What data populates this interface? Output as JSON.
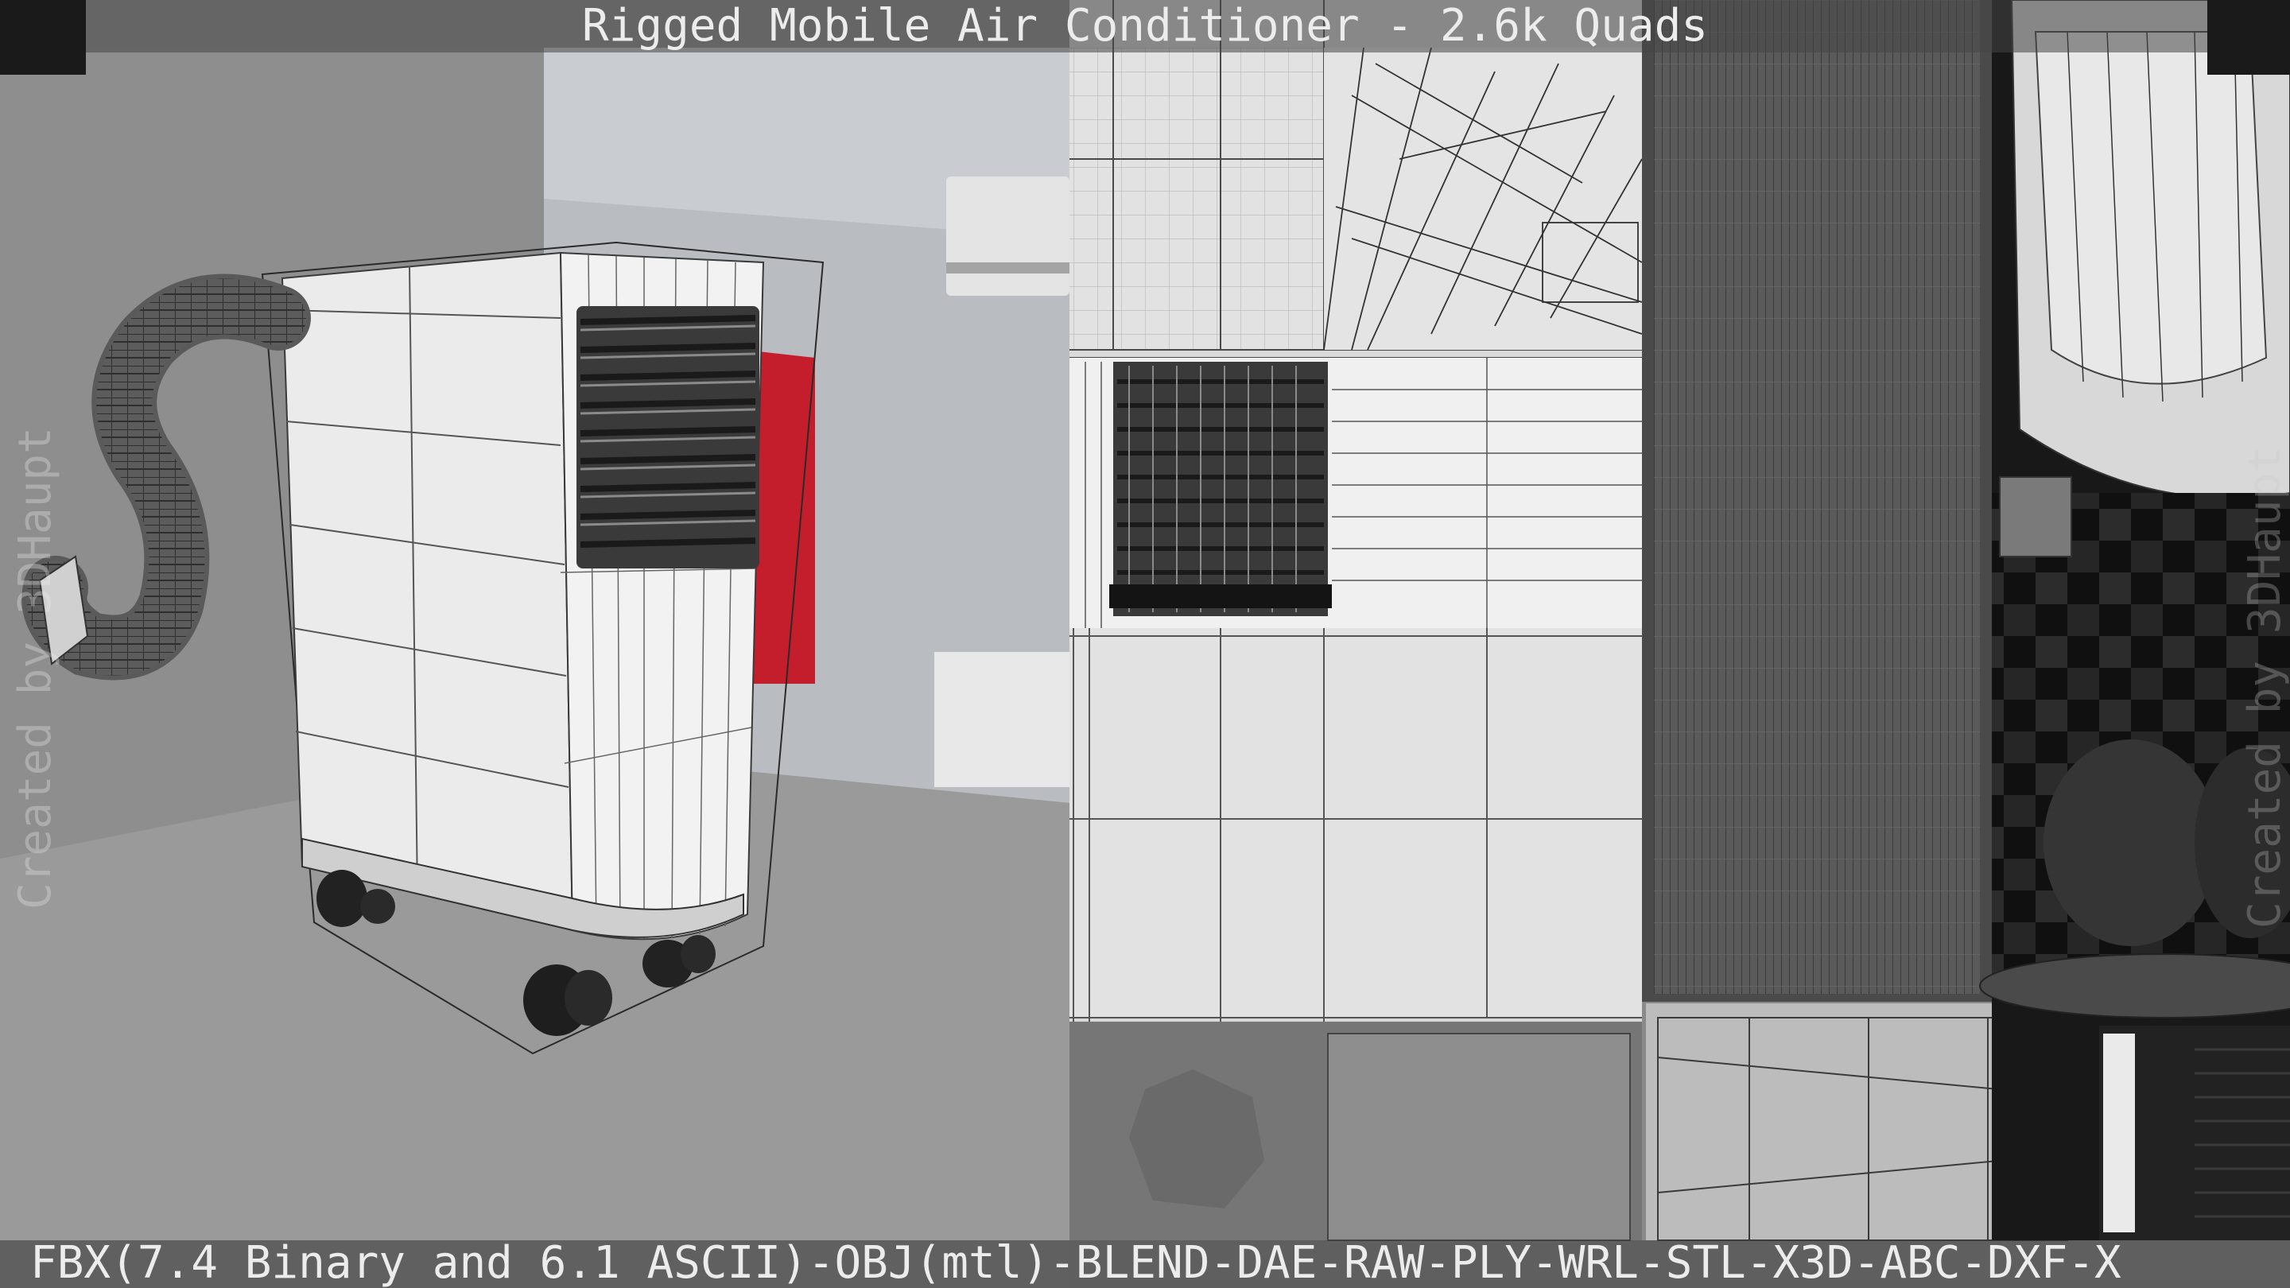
{
  "title": "Rigged Mobile Air Conditioner - 2.6k Quads",
  "formats_line": "FBX(7.4 Binary and 6.1 ASCII)-OBJ(mtl)-BLEND-DAE-RAW-PLY-WRL-STL-X3D-ABC-DXF-X",
  "watermark_left": "Created by 3DHaupt",
  "watermark_right": "Created by 3DHaupt",
  "colors": {
    "viewport_bg": "#8c8c8c",
    "floor": "#9a9a9a",
    "wall": "#b8bcc0",
    "red_panel": "#c41e2c",
    "uv_light": "#e6e6e6",
    "uv_dark": "#1c1c1c"
  }
}
